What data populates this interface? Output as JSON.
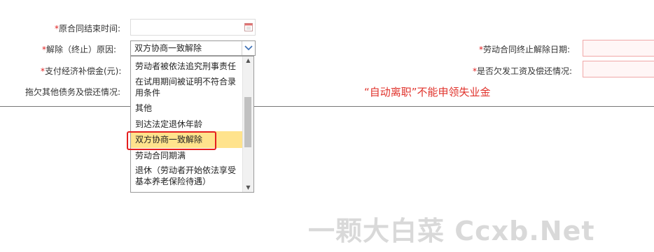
{
  "form": {
    "contract_end_time_label": "原合同结束时间:",
    "reason_label": "解除（终止）原因:",
    "compensation_label": "支付经济补偿金(元):",
    "debts_label": "拖欠其他债务及偿还情况:",
    "termination_date_label": "劳动合同终止解除日期:",
    "unpaid_wages_label": "是否欠发工资及偿还情况:",
    "required_mark": "*"
  },
  "reason_select": {
    "selected_value": "双方协商一致解除",
    "options": [
      "劳动者被依法追究刑事责任",
      "在试用期间被证明不符合录用条件",
      "其他",
      "到达法定退休年龄",
      "双方协商一致解除",
      "劳动合同期满",
      "退休（劳动者开始依法享受基本养老保险待遇）"
    ],
    "selected_index": 4
  },
  "annotation": {
    "note": "“自动离职”不能申领失业金"
  },
  "watermark": {
    "text": "一颗大白菜 Ccxb.Net"
  },
  "colors": {
    "required": "#e02020",
    "note": "#e0322b",
    "highlight_border": "#e51f1f",
    "selected_option_bg": "#ffe38d"
  },
  "icons": {
    "calendar": "calendar-icon",
    "dropdown_arrow": "chevron-down-icon"
  }
}
